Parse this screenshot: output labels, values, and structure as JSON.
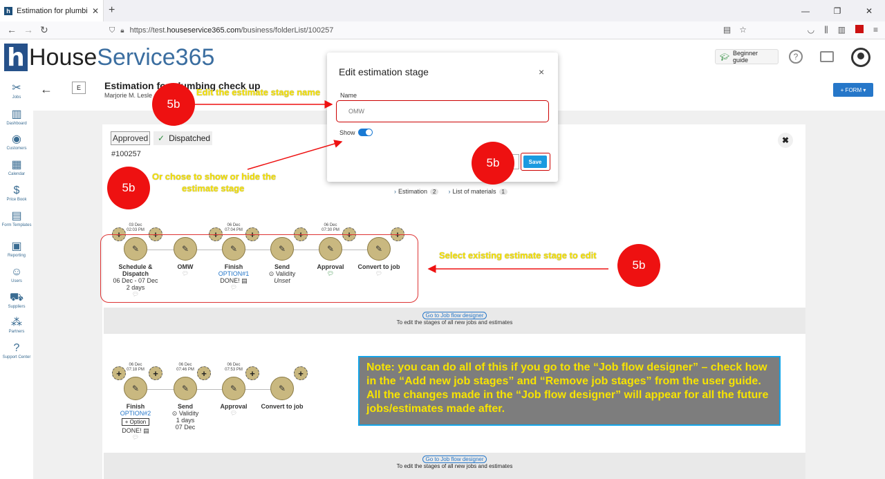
{
  "browser": {
    "tab_title": "Estimation for plumbing check",
    "url_prefix": "https://test.",
    "url_domain": "houseservice365.com",
    "url_path": "/business/folderList/100257"
  },
  "app": {
    "logo_part1": "House",
    "logo_part2": "Service365",
    "beginner_guide": "Beginner guide",
    "help": "?"
  },
  "sidebar": {
    "items": [
      {
        "label": "Jobs",
        "icon": "✂"
      },
      {
        "label": "Dashboard",
        "icon": "▥"
      },
      {
        "label": "Customers",
        "icon": "◉"
      },
      {
        "label": "Calendar",
        "icon": "▦"
      },
      {
        "label": "Price Book",
        "icon": "$"
      },
      {
        "label": "Form Templates",
        "icon": "▤"
      },
      {
        "label": "Reporting",
        "icon": "▣"
      },
      {
        "label": "Users",
        "icon": "☺"
      },
      {
        "label": "Suppliers",
        "icon": "⛟"
      },
      {
        "label": "Partners",
        "icon": "⁂"
      },
      {
        "label": "Support Center",
        "icon": "?"
      }
    ]
  },
  "page": {
    "title": "Estimation for plumbing check up",
    "subtitle": "Marjorie M. Lesle",
    "e_label": "E",
    "form_button": "+ FORM ▾",
    "status_approved": "Approved",
    "status_dispatched": "Dispatched",
    "job_number": "#100257",
    "tabs": [
      {
        "label": "Estimation",
        "count": "2"
      },
      {
        "label": "List of materials",
        "count": "1"
      }
    ]
  },
  "flow1": {
    "dates": [
      {
        "day": "03 Dec",
        "time": "02:03 PM"
      },
      {
        "day": "06 Dec",
        "time": "07:04 PM"
      },
      {
        "day": "06 Dec",
        "time": "07:30 PM"
      }
    ],
    "stages": [
      {
        "name": "Schedule &",
        "name2": "Dispatch",
        "line1": "06 Dec - 07 Dec",
        "line2": "2 days"
      },
      {
        "name": "OMW"
      },
      {
        "name": "Finish",
        "option": "OPTION#1",
        "line1": "DONE!"
      },
      {
        "name": "Send",
        "line1": "Validity",
        "line2": "Unset"
      },
      {
        "name": "Approval"
      },
      {
        "name": "Convert to job"
      }
    ]
  },
  "flow2": {
    "dates": [
      {
        "day": "06 Dec",
        "time": "07:18 PM"
      },
      {
        "day": "06 Dec",
        "time": "07:46 PM"
      },
      {
        "day": "06 Dec",
        "time": "07:53 PM"
      }
    ],
    "stages": [
      {
        "name": "Finish",
        "option": "OPTION#2",
        "button": "+ Option",
        "line1": "DONE!"
      },
      {
        "name": "Send",
        "line1": "Validity",
        "line2": "1 days",
        "line3": "07 Dec"
      },
      {
        "name": "Approval"
      },
      {
        "name": "Convert to job"
      }
    ]
  },
  "job_flow_designer": {
    "link": "Go to Job flow designer",
    "text": "To edit the stages of all new jobs and estimates"
  },
  "modal": {
    "title": "Edit estimation stage",
    "close": "×",
    "name_label": "Name",
    "name_value": "OMW",
    "show_label": "Show",
    "save": "Save"
  },
  "annotations": {
    "step": "5b",
    "edit_name": "Edit the estimate stage name",
    "show_hide_line1": "Or chose to show or hide the",
    "show_hide_line2": "estimate stage",
    "select_existing": "Select existing estimate stage to  edit",
    "note": "Note: you can do all of this if you go to the “Job flow designer” – check how in the “Add new job stages” and “Remove job stages” from the user guide. All the changes made in the “Job flow designer” will appear for all the future jobs/estimates made after."
  },
  "colors": {
    "accent": "#2677c9",
    "node": "#c9b880",
    "annotation_red": "#ee1111",
    "annotation_yellow": "#f7e300"
  }
}
